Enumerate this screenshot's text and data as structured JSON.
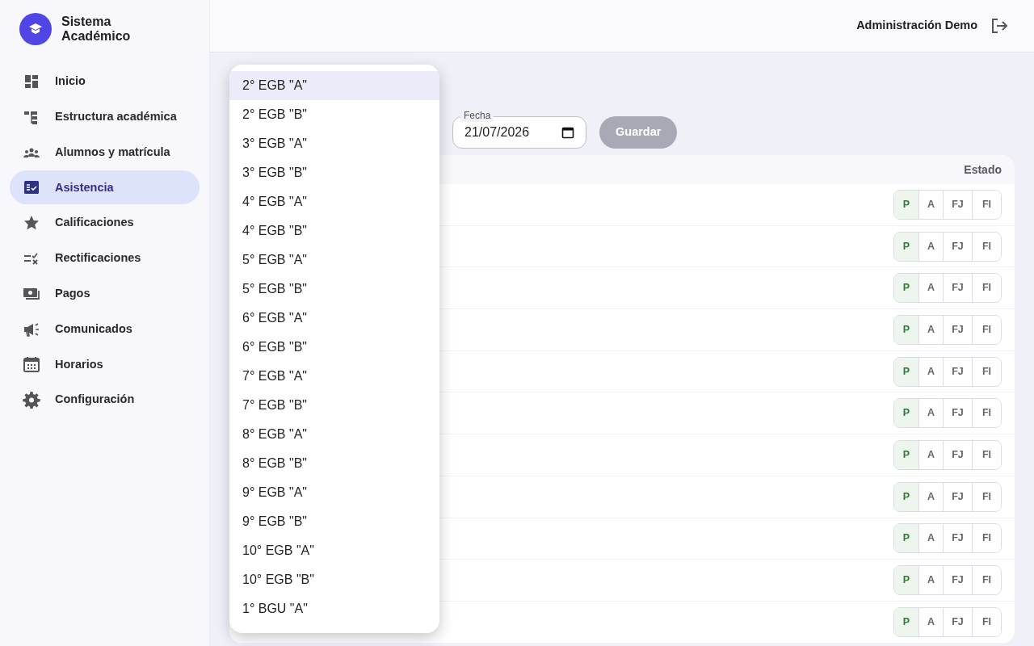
{
  "sidebar": {
    "brand": "Sistema Académico",
    "items": [
      {
        "label": "Inicio",
        "selected": false
      },
      {
        "label": "Estructura académica",
        "selected": false
      },
      {
        "label": "Alumnos y matrícula",
        "selected": false
      },
      {
        "label": "Asistencia",
        "selected": true
      },
      {
        "label": "Calificaciones",
        "selected": false
      },
      {
        "label": "Rectificaciones",
        "selected": false
      },
      {
        "label": "Pagos",
        "selected": false
      },
      {
        "label": "Comunicados",
        "selected": false
      },
      {
        "label": "Horarios",
        "selected": false
      },
      {
        "label": "Configuración",
        "selected": false
      }
    ]
  },
  "topbar": {
    "user": "Administración Demo"
  },
  "filters": {
    "date": {
      "label": "Fecha",
      "value": "21/07/2026"
    },
    "save_button": {
      "label": "Guardar",
      "disabled": true
    }
  },
  "table": {
    "columns": [
      "Estado"
    ],
    "rows": [
      {
        "options": [
          {
            "label": "P",
            "selected": true
          },
          {
            "label": "A",
            "selected": false
          },
          {
            "label": "FJ",
            "selected": false
          },
          {
            "label": "FI",
            "selected": false
          }
        ]
      },
      {
        "options": [
          {
            "label": "P",
            "selected": true
          },
          {
            "label": "A",
            "selected": false
          },
          {
            "label": "FJ",
            "selected": false
          },
          {
            "label": "FI",
            "selected": false
          }
        ]
      },
      {
        "options": [
          {
            "label": "P",
            "selected": true
          },
          {
            "label": "A",
            "selected": false
          },
          {
            "label": "FJ",
            "selected": false
          },
          {
            "label": "FI",
            "selected": false
          }
        ]
      },
      {
        "options": [
          {
            "label": "P",
            "selected": true
          },
          {
            "label": "A",
            "selected": false
          },
          {
            "label": "FJ",
            "selected": false
          },
          {
            "label": "FI",
            "selected": false
          }
        ]
      },
      {
        "options": [
          {
            "label": "P",
            "selected": true
          },
          {
            "label": "A",
            "selected": false
          },
          {
            "label": "FJ",
            "selected": false
          },
          {
            "label": "FI",
            "selected": false
          }
        ]
      },
      {
        "options": [
          {
            "label": "P",
            "selected": true
          },
          {
            "label": "A",
            "selected": false
          },
          {
            "label": "FJ",
            "selected": false
          },
          {
            "label": "FI",
            "selected": false
          }
        ]
      },
      {
        "options": [
          {
            "label": "P",
            "selected": true
          },
          {
            "label": "A",
            "selected": false
          },
          {
            "label": "FJ",
            "selected": false
          },
          {
            "label": "FI",
            "selected": false
          }
        ]
      },
      {
        "options": [
          {
            "label": "P",
            "selected": true
          },
          {
            "label": "A",
            "selected": false
          },
          {
            "label": "FJ",
            "selected": false
          },
          {
            "label": "FI",
            "selected": false
          }
        ]
      },
      {
        "options": [
          {
            "label": "P",
            "selected": true
          },
          {
            "label": "A",
            "selected": false
          },
          {
            "label": "FJ",
            "selected": false
          },
          {
            "label": "FI",
            "selected": false
          }
        ]
      },
      {
        "options": [
          {
            "label": "P",
            "selected": true
          },
          {
            "label": "A",
            "selected": false
          },
          {
            "label": "FJ",
            "selected": false
          },
          {
            "label": "FI",
            "selected": false
          }
        ]
      },
      {
        "options": [
          {
            "label": "P",
            "selected": true
          },
          {
            "label": "A",
            "selected": false
          },
          {
            "label": "FJ",
            "selected": false
          },
          {
            "label": "FI",
            "selected": false
          }
        ]
      }
    ]
  },
  "dropdown": {
    "options": [
      {
        "label": "2° EGB \"A\"",
        "selected": true
      },
      {
        "label": "2° EGB \"B\"",
        "selected": false
      },
      {
        "label": "3° EGB \"A\"",
        "selected": false
      },
      {
        "label": "3° EGB \"B\"",
        "selected": false
      },
      {
        "label": "4° EGB \"A\"",
        "selected": false
      },
      {
        "label": "4° EGB \"B\"",
        "selected": false
      },
      {
        "label": "5° EGB \"A\"",
        "selected": false
      },
      {
        "label": "5° EGB \"B\"",
        "selected": false
      },
      {
        "label": "6° EGB \"A\"",
        "selected": false
      },
      {
        "label": "6° EGB \"B\"",
        "selected": false
      },
      {
        "label": "7° EGB \"A\"",
        "selected": false
      },
      {
        "label": "7° EGB \"B\"",
        "selected": false
      },
      {
        "label": "8° EGB \"A\"",
        "selected": false
      },
      {
        "label": "8° EGB \"B\"",
        "selected": false
      },
      {
        "label": "9° EGB \"A\"",
        "selected": false
      },
      {
        "label": "9° EGB \"B\"",
        "selected": false
      },
      {
        "label": "10° EGB \"A\"",
        "selected": false
      },
      {
        "label": "10° EGB \"B\"",
        "selected": false
      },
      {
        "label": "1° BGU \"A\"",
        "selected": false
      }
    ]
  }
}
